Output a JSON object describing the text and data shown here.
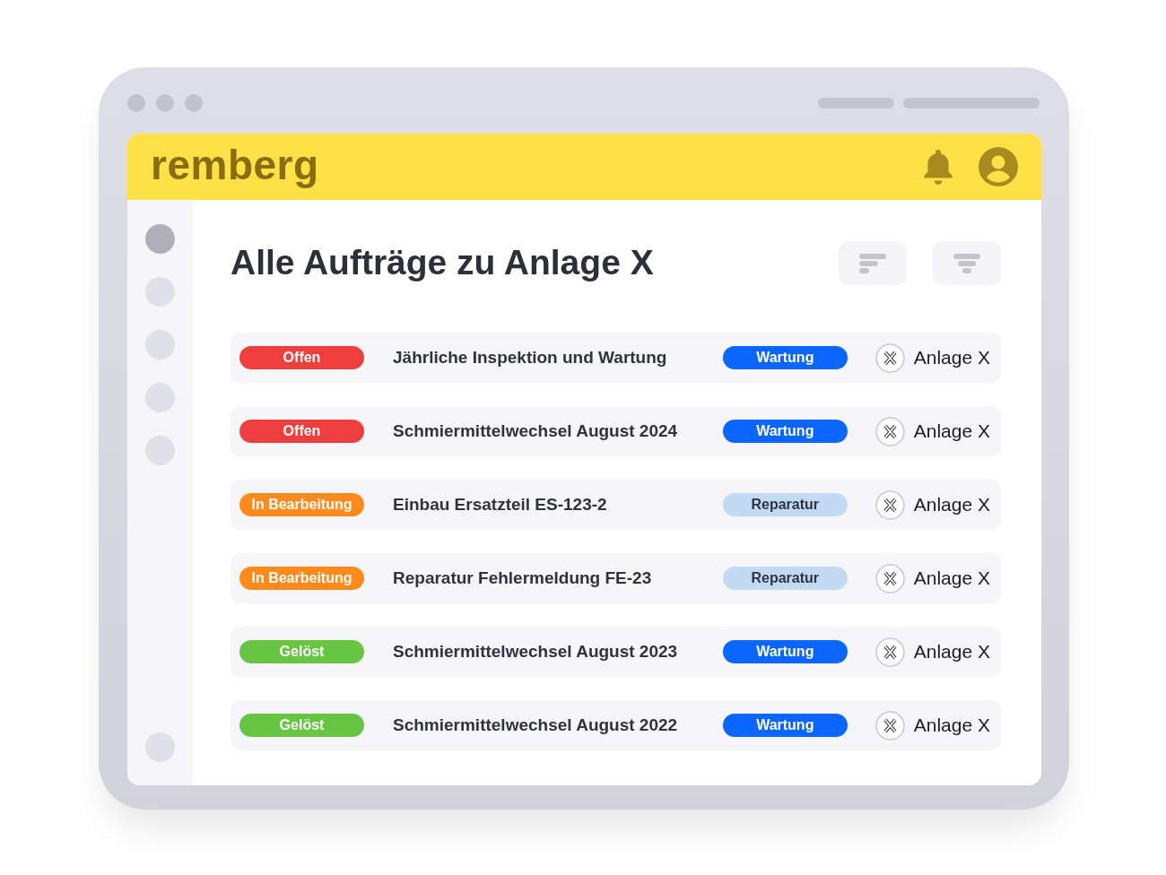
{
  "header": {
    "logo": "remberg"
  },
  "sidebar": {
    "items": [
      {
        "selected": true
      },
      {
        "selected": false
      },
      {
        "selected": false
      },
      {
        "selected": false
      },
      {
        "selected": false
      }
    ],
    "footer_items": [
      {
        "selected": false
      }
    ]
  },
  "page": {
    "title": "Alle Aufträge zu Anlage X"
  },
  "orders": [
    {
      "status": {
        "label": "Offen",
        "color": "#ee3e3e"
      },
      "title": "Jährliche Inspektion und Wartung",
      "type": {
        "label": "Wartung",
        "color": "#0a66ff"
      },
      "asset": "Anlage X"
    },
    {
      "status": {
        "label": "Offen",
        "color": "#ee3e3e"
      },
      "title": "Schmiermittelwechsel August 2024",
      "type": {
        "label": "Wartung",
        "color": "#0a66ff"
      },
      "asset": "Anlage X"
    },
    {
      "status": {
        "label": "In Bearbeitung",
        "color": "#ff8a1c"
      },
      "title": "Einbau Ersatzteil ES-123-2",
      "type": {
        "label": "Reparatur",
        "color": "#c3daf3"
      },
      "asset": "Anlage X"
    },
    {
      "status": {
        "label": "In Bearbeitung",
        "color": "#ff8a1c"
      },
      "title": "Reparatur Fehlermeldung FE-23",
      "type": {
        "label": "Reparatur",
        "color": "#c3daf3"
      },
      "asset": "Anlage X"
    },
    {
      "status": {
        "label": "Gelöst",
        "color": "#66c541"
      },
      "title": "Schmiermittelwechsel August 2023",
      "type": {
        "label": "Wartung",
        "color": "#0a66ff"
      },
      "asset": "Anlage X"
    },
    {
      "status": {
        "label": "Gelöst",
        "color": "#66c541"
      },
      "title": "Schmiermittelwechsel August 2022",
      "type": {
        "label": "Wartung",
        "color": "#0a66ff"
      },
      "asset": "Anlage X"
    }
  ]
}
